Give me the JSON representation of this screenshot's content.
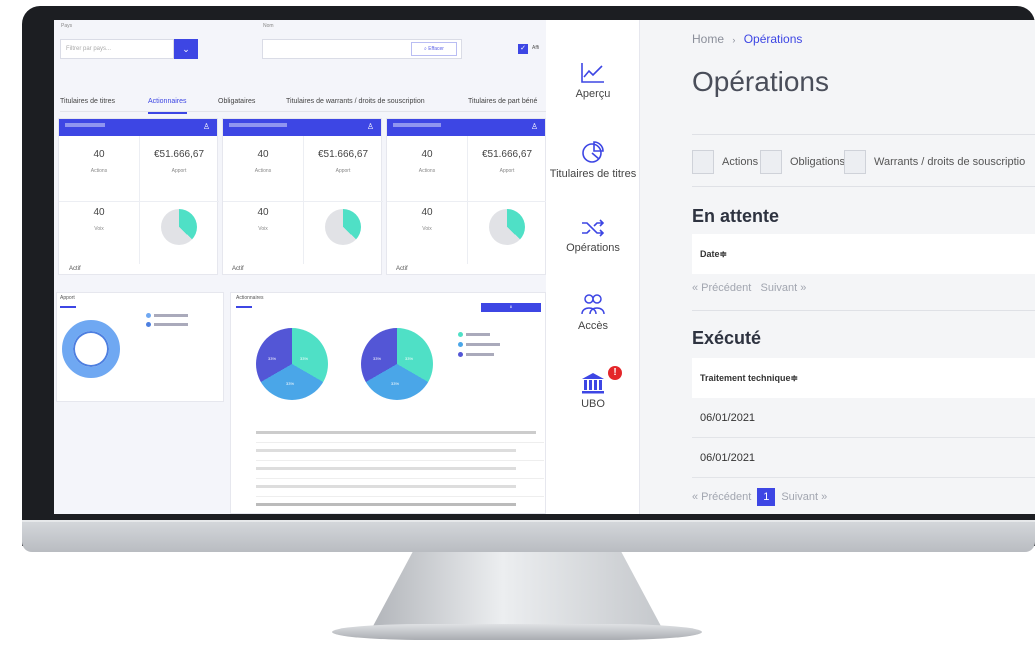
{
  "dashboard": {
    "filter_country_label": "Pays",
    "filter_country_placeholder": "Filtrer par pays...",
    "filter_name_label": "Nom",
    "clear_button": "Effacer",
    "checkbox_label": "Affi",
    "tabs": [
      "Titulaires de titres",
      "Actionnaires",
      "Obligataires",
      "Titulaires de warrants / droits de souscription",
      "Titulaires de part béné"
    ],
    "cards": [
      {
        "actions": "40",
        "actions_label": "Actions",
        "apport": "€51.666,67",
        "apport_label": "Apport",
        "voix": "40",
        "voix_label": "Voix",
        "footer": "Actif",
        "pie_share": 0.37
      },
      {
        "actions": "40",
        "actions_label": "Actions",
        "apport": "€51.666,67",
        "apport_label": "Apport",
        "voix": "40",
        "voix_label": "Voix",
        "footer": "Actif",
        "pie_share": 0.37
      },
      {
        "actions": "40",
        "actions_label": "Actions",
        "apport": "€51.666,67",
        "apport_label": "Apport",
        "voix": "40",
        "voix_label": "Voix",
        "footer": "Actif",
        "pie_share": 0.37
      }
    ],
    "apport_panel_title": "Apport",
    "actionnaires_panel_title": "Actionnaires",
    "pie_labels": [
      "33%",
      "33%",
      "33%"
    ]
  },
  "sidebar": {
    "items": [
      {
        "label": "Aperçu",
        "icon": "line-chart-icon"
      },
      {
        "label": "Titulaires de titres",
        "icon": "pie-chart-icon"
      },
      {
        "label": "Opérations",
        "icon": "shuffle-icon"
      },
      {
        "label": "Accès",
        "icon": "users-icon"
      },
      {
        "label": "UBO",
        "icon": "bank-icon",
        "alert": "!"
      }
    ]
  },
  "main": {
    "breadcrumb_home": "Home",
    "breadcrumb_sep": "›",
    "breadcrumb_current": "Opérations",
    "title": "Opérations",
    "filters": [
      "Actions",
      "Obligations",
      "Warrants / droits de souscriptio"
    ],
    "pending_title": "En attente",
    "pending_column": "Date≑",
    "pending_prev": "« Précédent",
    "pending_next": "Suivant »",
    "executed_title": "Exécuté",
    "executed_column": "Traitement technique≑",
    "executed_rows": [
      "06/01/2021",
      "06/01/2021"
    ],
    "executed_prev": "« Précédent",
    "executed_page": "1",
    "executed_next": "Suivant »"
  },
  "colors": {
    "accent": "#3d46e4",
    "teal": "#4fe0c6",
    "alert": "#e4262a"
  }
}
